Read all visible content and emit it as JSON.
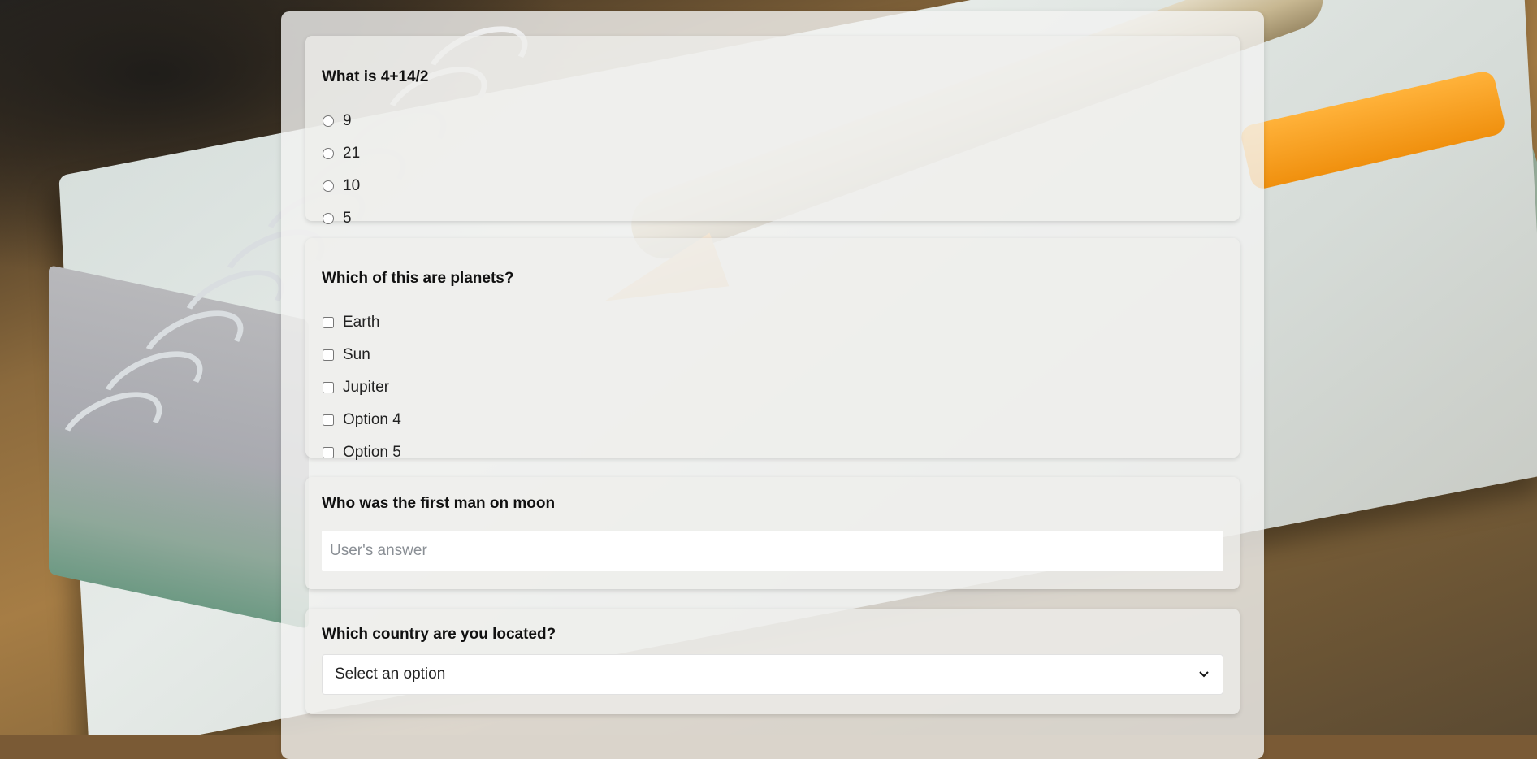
{
  "questions": [
    {
      "title": "What is 4+14/2",
      "type": "radio",
      "options": [
        "9",
        "21",
        "10",
        "5"
      ]
    },
    {
      "title": "Which of this are planets?",
      "type": "checkbox",
      "options": [
        "Earth",
        "Sun",
        "Jupiter",
        "Option 4",
        "Option 5"
      ]
    },
    {
      "title": "Who was the first man on moon",
      "type": "text",
      "placeholder": "User's answer",
      "value": ""
    },
    {
      "title": "Which country are you located?",
      "type": "select",
      "selected": "Select an option"
    }
  ],
  "icons": {
    "select_arrow": "chevron-down-icon"
  }
}
